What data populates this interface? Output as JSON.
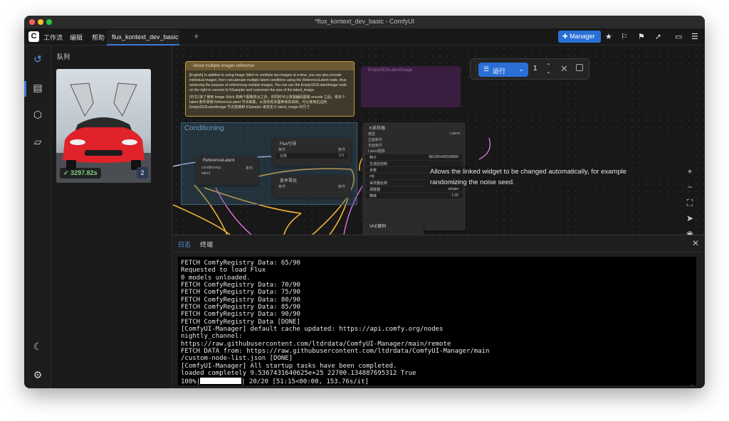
{
  "window": {
    "title": "*flux_kontext_dev_basic - ComfyUI"
  },
  "menu": {
    "items": [
      "工作流",
      "编辑",
      "帮助"
    ],
    "active_tab": "flux_kontext_dev_basic",
    "manager_label": "Manager"
  },
  "queue": {
    "title": "队列",
    "items": [
      {
        "time": "3297.82s",
        "count": "2"
      }
    ]
  },
  "canvas": {
    "note_title": "About multiple images reference",
    "note_en": "[English] In addition to using Image Stitch to combine two images at a time, you can also encode individual images, then concatenate multiple latent conditions using the ReferenceLatent node, thus achieving the purpose of referencing multiple images. You can use the EmptySD3LatentImage node on the right to connect to KSampler and customize the size of the latent_image.",
    "note_zh": "[中文] 除了使用 Image Stitch 将两个图像拼合之外，你同时可以单独编码图像 encode 之后，将多个 latent 条件使用 ReferenceLatent 节点串联，从而实现多图参考的目的。可以使用右边的 EmptySD3LatentImage 节点连接到 KSampler 来自定义 latent_image 的尺寸",
    "group_title": "Conditioning",
    "flux_node": {
      "title": "Flux引导",
      "in": "条件",
      "out": "条件",
      "widget_label": "引导",
      "widget_value": "2.5"
    },
    "ref_node": {
      "title": "ReferenceLatent",
      "in1": "conditioning",
      "in2": "latent",
      "out": "条件"
    },
    "zero_node": {
      "title": "条件零化",
      "in": "条件",
      "out": "条件"
    },
    "purple_node_title": "EmptySD3LatentImage",
    "ksampler": {
      "title": "K采样器",
      "inputs": [
        "模型",
        "正面条件",
        "负面条件",
        "Latent图像"
      ],
      "output": "Latent",
      "widgets": [
        {
          "label": "种子",
          "value": "981365420039690"
        },
        {
          "label": "生成后控制",
          "value": ""
        },
        {
          "label": "步数",
          "value": ""
        },
        {
          "label": "cfg",
          "value": ""
        },
        {
          "label": "采样器名称",
          "value": "euler"
        },
        {
          "label": "调度器",
          "value": "simple"
        },
        {
          "label": "降噪",
          "value": "1.00"
        }
      ]
    },
    "vae_title": "VAE解码",
    "run_label": "运行",
    "batch_count": "1",
    "tooltip": "Allows the linked widget to be changed automatically, for example randomizing the noise seed."
  },
  "log": {
    "tabs": [
      "日志",
      "终端"
    ],
    "lines": [
      "FETCH ComfyRegistry Data: 65/90",
      "Requested to load Flux",
      "0 models unloaded.",
      "FETCH ComfyRegistry Data: 70/90",
      "FETCH ComfyRegistry Data: 75/90",
      "FETCH ComfyRegistry Data: 80/90",
      "FETCH ComfyRegistry Data: 85/90",
      "FETCH ComfyRegistry Data: 90/90",
      "FETCH ComfyRegistry Data [DONE]",
      "[ComfyUI-Manager] default cache updated: https://api.comfy.org/nodes",
      "nightly_channel:",
      "https://raw.githubusercontent.com/ltdrdata/ComfyUI-Manager/main/remote",
      "FETCH DATA from: https://raw.githubusercontent.com/ltdrdata/ComfyUI-Manager/main",
      "/custom-node-list.json [DONE]",
      "[ComfyUI-Manager] All startup tasks have been completed.",
      "loaded completely 9.5367431640625e+25 22700.134887695312 True"
    ],
    "progress_percent": "100%",
    "progress_fraction": 1.0,
    "progress_suffix": " 20/20 [51:15<00:00, 153.76s/it]"
  }
}
